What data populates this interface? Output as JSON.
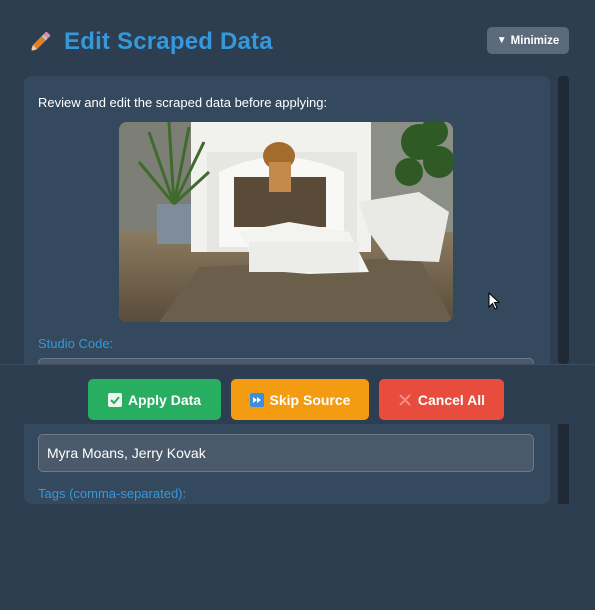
{
  "dialog": {
    "title": "Edit Scraped Data",
    "minimize_label": "Minimize",
    "icons": {
      "title_icon": "pencil-icon",
      "minimize_icon": "triangle-down-icon"
    }
  },
  "content": {
    "intro": "Review and edit the scraped data before applying:",
    "fields": {
      "studio_code": {
        "label": "Studio Code:",
        "value": ""
      },
      "performers": {
        "value": "Myra Moans, Jerry Kovak"
      },
      "tags": {
        "label": "Tags (comma-separated):"
      }
    }
  },
  "actions": {
    "apply_label": "Apply Data",
    "skip_label": "Skip Source",
    "cancel_label": "Cancel All",
    "icons": {
      "apply": "check-box-icon",
      "skip": "fast-forward-icon",
      "cancel": "x-icon"
    }
  },
  "colors": {
    "background": "#2c3e50",
    "panel": "#34495e",
    "accent": "#3498db",
    "apply": "#27ae60",
    "skip": "#f39c12",
    "cancel": "#e74c3c"
  }
}
